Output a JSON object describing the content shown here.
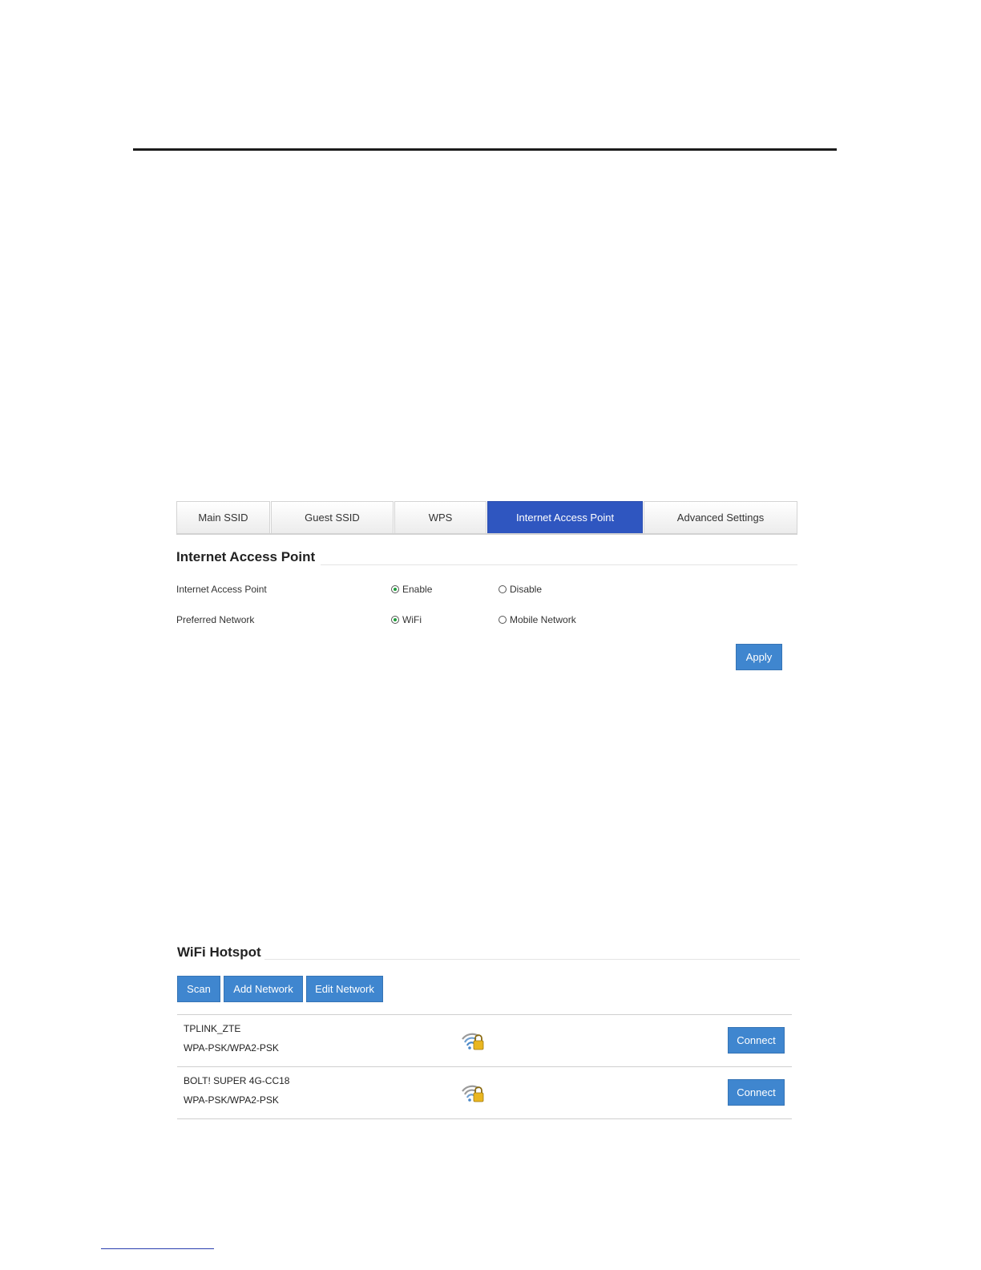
{
  "tabs": [
    {
      "label": "Main SSID",
      "active": false
    },
    {
      "label": "Guest SSID",
      "active": false
    },
    {
      "label": "WPS",
      "active": false
    },
    {
      "label": "Internet Access Point",
      "active": true
    },
    {
      "label": "Advanced Settings",
      "active": false
    }
  ],
  "access_point": {
    "title": "Internet Access Point",
    "rows": [
      {
        "label": "Internet Access Point",
        "option1": "Enable",
        "option2": "Disable",
        "selected": "Enable"
      },
      {
        "label": "Preferred Network",
        "option1": "WiFi",
        "option2": "Mobile Network",
        "selected": "WiFi"
      }
    ],
    "apply_label": "Apply"
  },
  "hotspot": {
    "title": "WiFi Hotspot",
    "scan_label": "Scan",
    "add_label": "Add Network",
    "edit_label": "Edit Network",
    "networks": [
      {
        "ssid": "TPLINK_ZTE",
        "security": "WPA-PSK/WPA2-PSK",
        "icon": "wifi-locked-icon",
        "action": "Connect"
      },
      {
        "ssid": "BOLT! SUPER 4G-CC18",
        "security": "WPA-PSK/WPA2-PSK",
        "icon": "wifi-locked-icon",
        "action": "Connect"
      }
    ]
  },
  "colors": {
    "accent": "#3f86cf",
    "active_tab": "#2f56c0",
    "radio_on": "#1e9c3b"
  }
}
